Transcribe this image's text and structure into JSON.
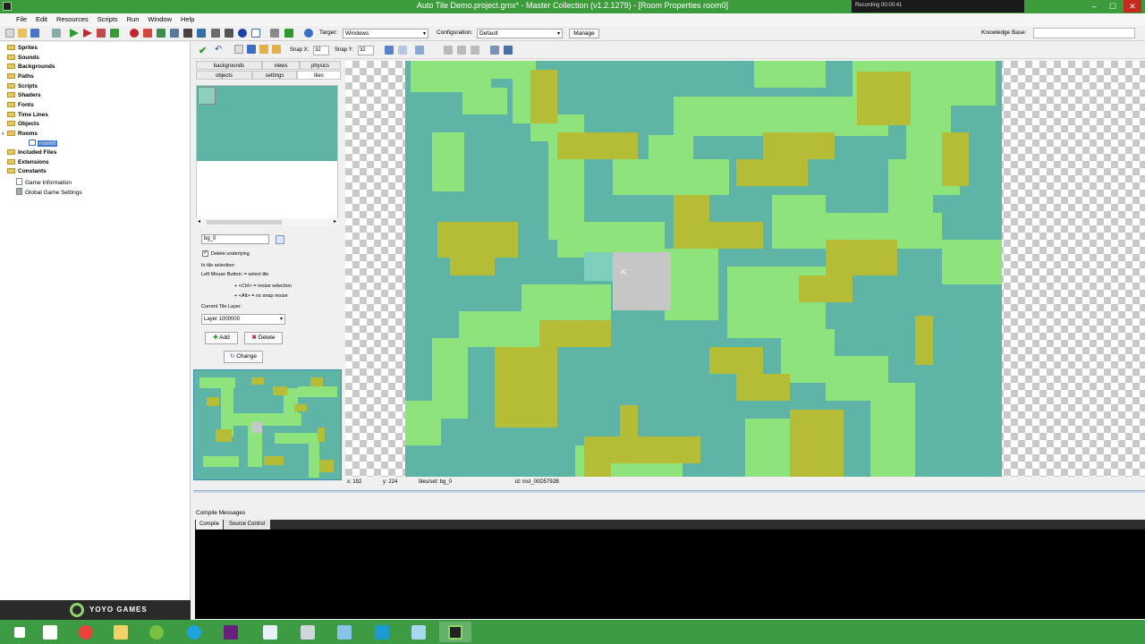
{
  "window": {
    "title": "Auto Tile Demo.project.gmx*  -  Master Collection (v1.2.1279)  -  [Room Properties room0]",
    "recording_text": "Recording 00:00:41",
    "minimize": "–",
    "maximize": "☐",
    "close": "✕"
  },
  "menu": [
    "File",
    "Edit",
    "Resources",
    "Scripts",
    "Run",
    "Window",
    "Help"
  ],
  "toolbar": {
    "target_label": "Target:",
    "target_value": "Windows",
    "config_label": "Configuration:",
    "config_value": "Default",
    "manage_label": "Manage",
    "kb_label": "Knowledge Base:"
  },
  "tree": {
    "folders": [
      "Sprites",
      "Sounds",
      "Backgrounds",
      "Paths",
      "Scripts",
      "Shaders",
      "Fonts",
      "Time Lines",
      "Objects",
      "Rooms"
    ],
    "room_item": "room0",
    "folders_after": [
      "Included Files",
      "Extensions",
      "Constants"
    ],
    "items_after": [
      "Game Information",
      "Global Game Settings"
    ],
    "logo": "YOYO GAMES"
  },
  "room_toolbar": {
    "snap_x_label": "Snap X:",
    "snap_x": "32",
    "snap_y_label": "Snap Y:",
    "snap_y": "32"
  },
  "tabs_row1": [
    "backgrounds",
    "views",
    "physics"
  ],
  "tabs_row2": [
    "objects",
    "settings",
    "tiles"
  ],
  "tile_panel": {
    "background_name": "bg_0",
    "delete_underlying": "Delete underlying",
    "help1": "In tile selection:",
    "help2": "Left Mouse Button:  = select tile",
    "help3": "+ <Ctrl>  = resize selection",
    "help4": "+ <Alt>  = no snap resize",
    "layer_label": "Current Tile Layer:",
    "layer_value": "Layer 1000000",
    "add_label": "Add",
    "delete_label": "Delete",
    "change_label": "Change"
  },
  "status": {
    "x": "x: 192",
    "y": "y: 224",
    "tile": "tiles/set: bg_0",
    "id": "id: inst_00D5792B"
  },
  "compile": {
    "title": "Compile Messages",
    "tab1": "Compile",
    "tab2": "Source Control"
  },
  "colors": {
    "titlebar": "#3c9c3c",
    "water": "#5fb5a5",
    "grass": "#8ee37c",
    "bush": "#b4bd35",
    "taskbar": "#3c9b43"
  }
}
